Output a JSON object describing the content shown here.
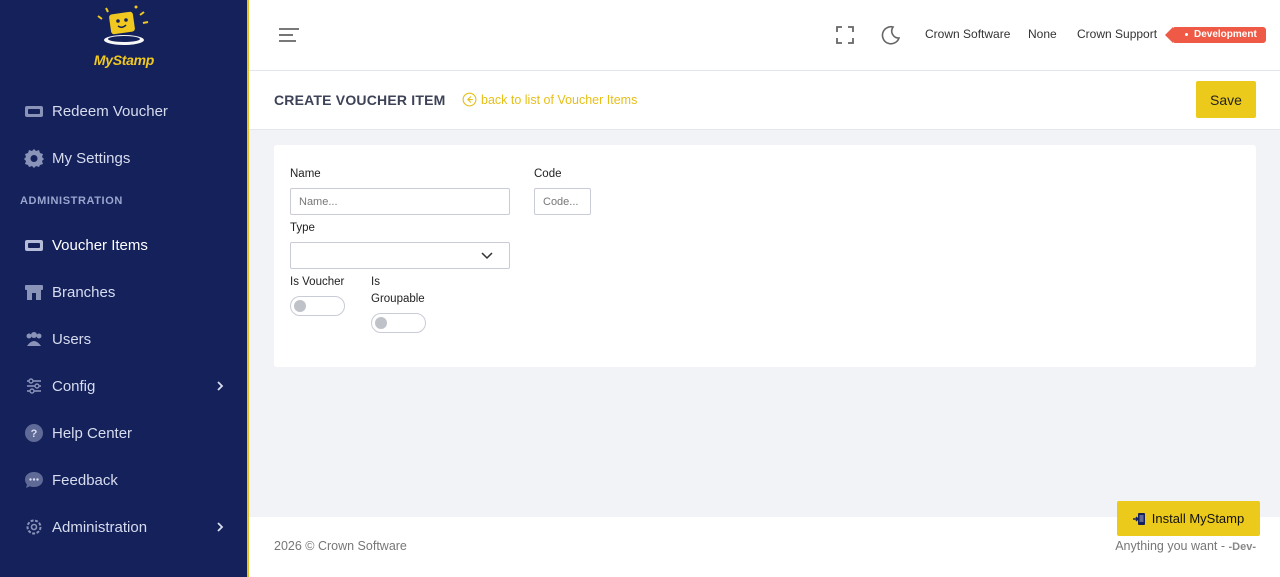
{
  "brand": {
    "logo_text": "MyStamp"
  },
  "sidebar": {
    "items": [
      {
        "label": "Redeem Voucher",
        "icon": "ticket-icon",
        "active": false
      },
      {
        "label": "My Settings",
        "icon": "gear-icon",
        "active": false
      }
    ],
    "section_label": "ADMINISTRATION",
    "admin_items": [
      {
        "label": "Voucher Items",
        "icon": "ticket-icon",
        "active": true
      },
      {
        "label": "Branches",
        "icon": "store-icon",
        "active": false
      },
      {
        "label": "Users",
        "icon": "users-icon",
        "active": false
      },
      {
        "label": "Config",
        "icon": "sliders-icon",
        "active": false,
        "has_submenu": true
      },
      {
        "label": "Help Center",
        "icon": "help-icon",
        "active": false
      },
      {
        "label": "Feedback",
        "icon": "chat-icon",
        "active": false
      },
      {
        "label": "Administration",
        "icon": "cog-outline-icon",
        "active": false,
        "has_submenu": true
      }
    ]
  },
  "topbar": {
    "company": "Crown Software",
    "branch": "None",
    "user": "Crown Support",
    "environment": "Development"
  },
  "header": {
    "title": "CREATE VOUCHER ITEM",
    "back_link": "back to list of Voucher Items",
    "save_label": "Save"
  },
  "form": {
    "name_label": "Name",
    "name_placeholder": "Name...",
    "code_label": "Code",
    "code_placeholder": "Code...",
    "type_label": "Type",
    "type_value": "",
    "is_voucher_label": "Is Voucher",
    "is_voucher_value": false,
    "is_groupable_label_1": "Is",
    "is_groupable_label_2": "Groupable",
    "is_groupable_value": false
  },
  "footer": {
    "copyright": "2026 © Crown Software",
    "tagline": "Anything you want - ",
    "tagline_env": "-Dev-"
  },
  "install_button": "Install MyStamp",
  "colors": {
    "sidebar_bg": "#14215a",
    "accent": "#ecca1b",
    "badge": "#ee5a45"
  }
}
